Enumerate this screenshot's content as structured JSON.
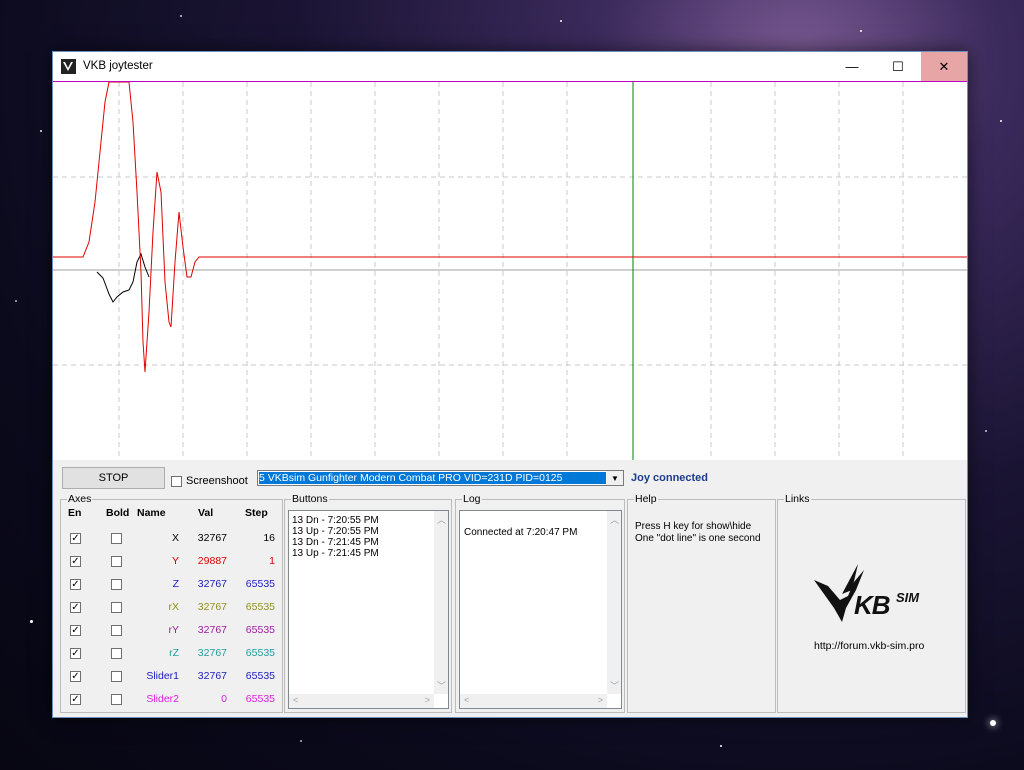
{
  "window": {
    "title": "VKB joytester"
  },
  "titlebar": {
    "minimize_glyph": "—",
    "maximize_glyph": "☐",
    "close_glyph": "✕"
  },
  "colors": {
    "axis_x": "#000000",
    "axis_y": "#e00000",
    "axis_z": "#2020c0",
    "axis_rx": "#909020",
    "axis_ry": "#a020a0",
    "axis_rz": "#20a0a0",
    "slider1": "#2020c0",
    "slider2": "#e020e0",
    "joy_connected": "#1c3d8c",
    "plot_border": "#c000c0",
    "cursor_line": "#008000"
  },
  "controls": {
    "stop_label": "STOP",
    "screenshoot_label": "Screenshoot",
    "screenshoot_checked": false,
    "device_selected": "5 VKBsim Gunfighter Modern Combat PRO  VID=231D PID=0125",
    "status": "Joy connected"
  },
  "axes_group": {
    "title": "Axes",
    "headers": {
      "en": "En",
      "bold": "Bold",
      "name": "Name",
      "val": "Val",
      "step": "Step"
    },
    "rows": [
      {
        "enabled": true,
        "bold": false,
        "name": "X",
        "val": "32767",
        "step": "16",
        "color": "#000000"
      },
      {
        "enabled": true,
        "bold": false,
        "name": "Y",
        "val": "29887",
        "step": "1",
        "color": "#e00000"
      },
      {
        "enabled": true,
        "bold": false,
        "name": "Z",
        "val": "32767",
        "step": "65535",
        "color": "#2020c0"
      },
      {
        "enabled": true,
        "bold": false,
        "name": "rX",
        "val": "32767",
        "step": "65535",
        "color": "#909020"
      },
      {
        "enabled": true,
        "bold": false,
        "name": "rY",
        "val": "32767",
        "step": "65535",
        "color": "#a020a0"
      },
      {
        "enabled": true,
        "bold": false,
        "name": "rZ",
        "val": "32767",
        "step": "65535",
        "color": "#20a0a0"
      },
      {
        "enabled": true,
        "bold": false,
        "name": "Slider1",
        "val": "32767",
        "step": "65535",
        "color": "#2020c0"
      },
      {
        "enabled": true,
        "bold": false,
        "name": "Slider2",
        "val": "0",
        "step": "65535",
        "color": "#e020e0"
      }
    ]
  },
  "buttons_group": {
    "title": "Buttons",
    "events": [
      "13 Dn - 7:20:55 PM",
      "13 Up - 7:20:55 PM",
      "13 Dn - 7:21:45 PM",
      "13 Up - 7:21:45 PM"
    ]
  },
  "log_group": {
    "title": "Log",
    "lines": [
      "Connected at 7:20:47 PM"
    ]
  },
  "help_group": {
    "title": "Help",
    "lines": [
      "Press H key for show\\hide",
      "One \"dot line\" is one second"
    ]
  },
  "links_group": {
    "title": "Links",
    "logo_text": "KB",
    "logo_sup": "SIM",
    "url": "http://forum.vkb-sim.pro"
  }
}
